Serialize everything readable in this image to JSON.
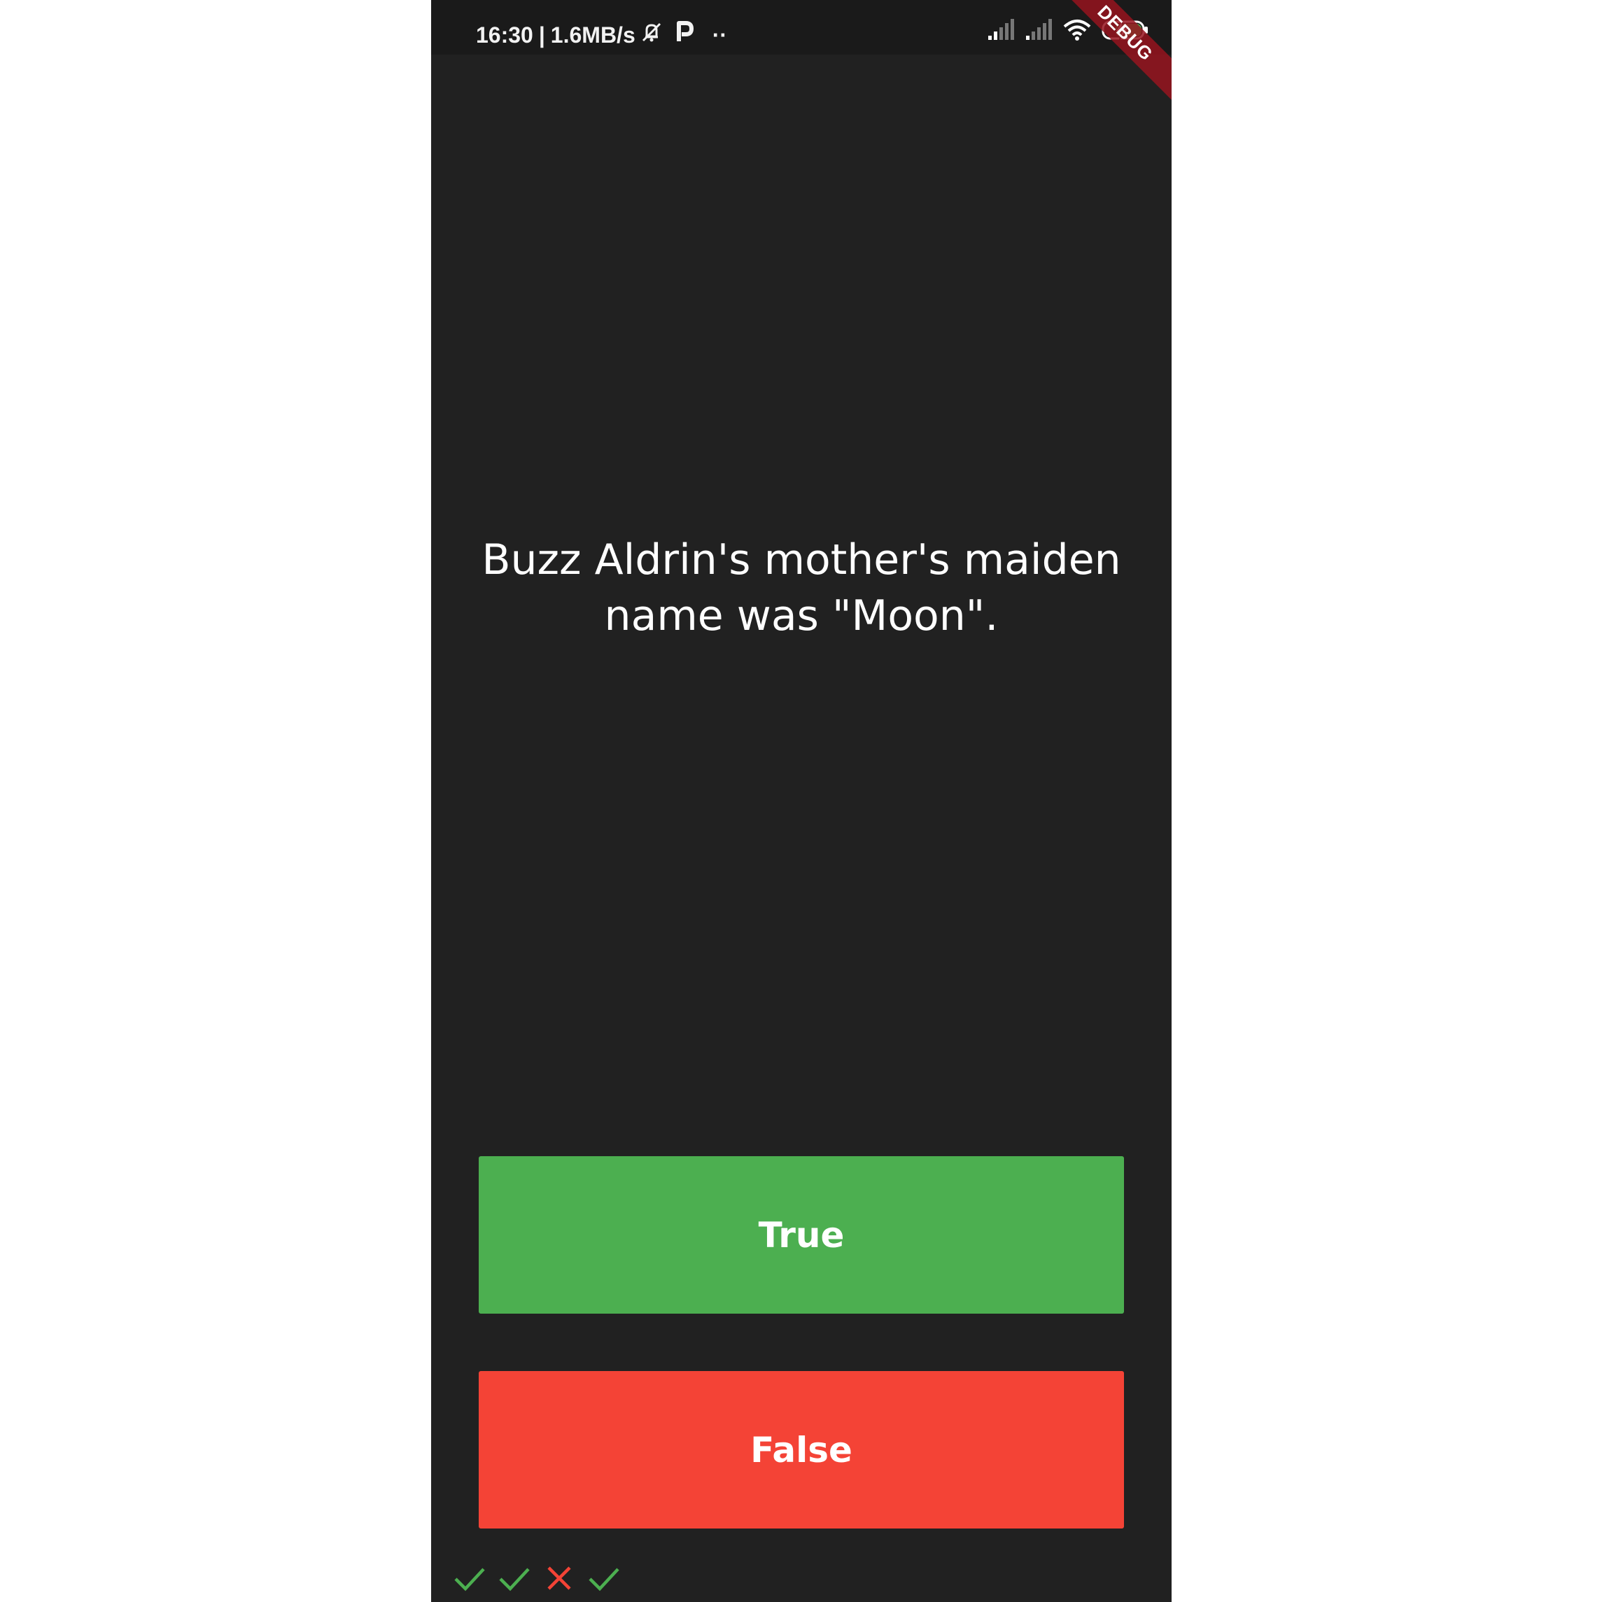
{
  "status_bar": {
    "time": "16:30",
    "separator": "|",
    "network_speed": "1.6MB/s",
    "icons": [
      "mute-bell-icon",
      "p-app-icon",
      "more-dots-icon",
      "cell-signal-icon",
      "cell-signal-icon",
      "wifi-icon",
      "battery-charging-icon"
    ],
    "more_dots": "··"
  },
  "debug_banner": {
    "label": "DEBUG"
  },
  "quiz": {
    "question": "Buzz Aldrin's mother's maiden name was \"Moon\"."
  },
  "buttons": {
    "true_label": "True",
    "false_label": "False",
    "true_color": "#4caf50",
    "false_color": "#f44336"
  },
  "score_keeper": {
    "marks": [
      "correct",
      "correct",
      "incorrect",
      "correct"
    ],
    "correct_color": "#4caf50",
    "incorrect_color": "#f44336"
  }
}
